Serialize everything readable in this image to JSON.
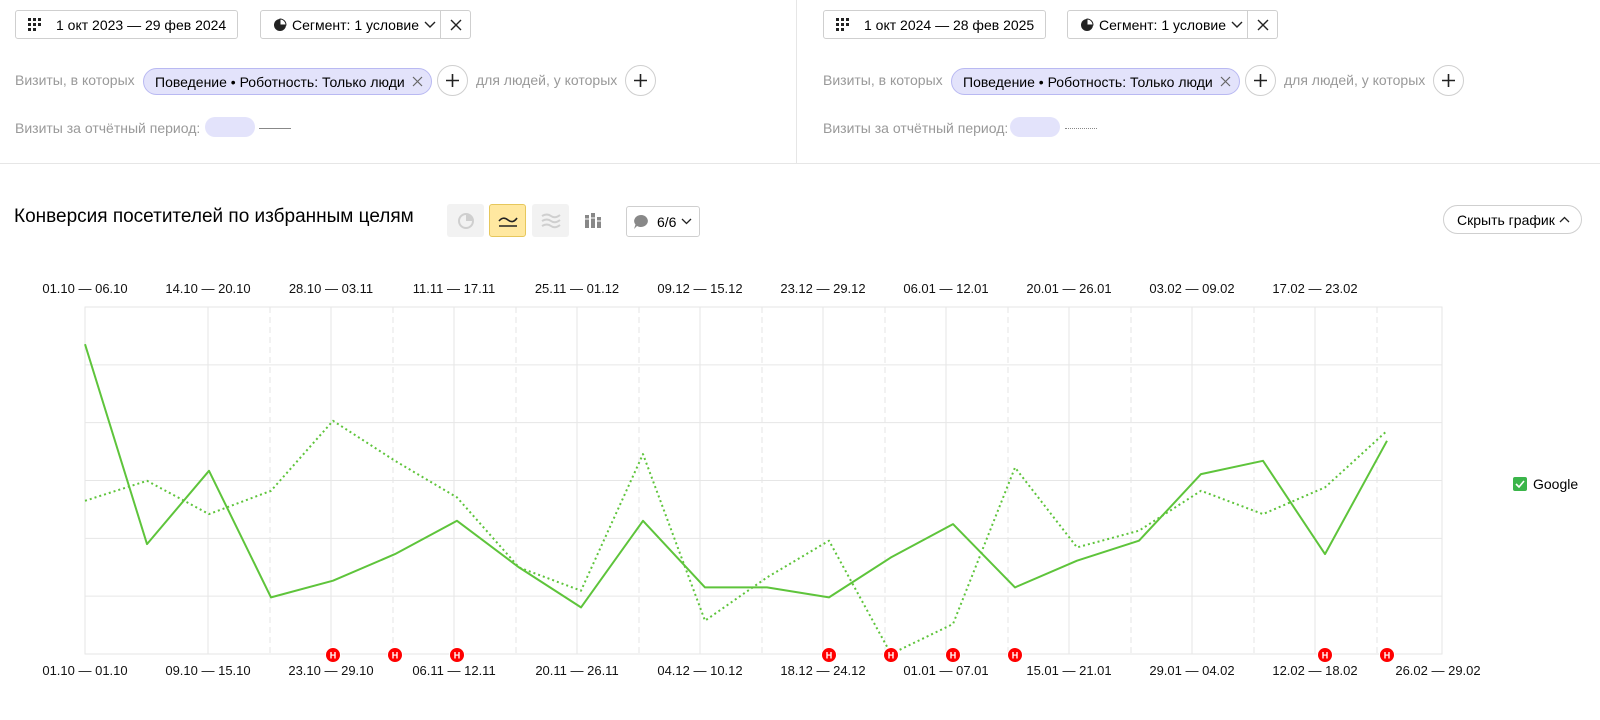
{
  "left_panel": {
    "date_range": "1 окт 2023 — 29 фев 2024",
    "segment_label": "Сегмент: 1 условие",
    "visits_where": "Визиты, в которых",
    "chip": "Поведение • Роботность: Только люди",
    "for_people": "для людей, у которых",
    "visits_period": "Визиты за отчётный период:"
  },
  "right_panel": {
    "date_range": "1 окт 2024 — 28 фев 2025",
    "segment_label": "Сегмент: 1 условие",
    "visits_where": "Визиты, в которых",
    "chip": "Поведение • Роботность: Только люди",
    "for_people": "для людей, у которых",
    "visits_period": "Визиты за отчётный период:"
  },
  "toolbar": {
    "title": "Конверсия посетителей по избранным целям",
    "notes_count": "6/6",
    "hide_chart": "Скрыть график"
  },
  "colors": {
    "series": "#5ec43b",
    "accent": "#ffe8a0",
    "note": "#f00",
    "grid": "#e6e6e6"
  },
  "chart_data": {
    "type": "line",
    "title": "Конверсия посетителей по избранным целям",
    "grid": true,
    "legend_position": "right",
    "y_tick_label": "",
    "ylim": [
      0,
      100
    ],
    "x_top_labels": [
      "01.10 — 06.10",
      "14.10 — 20.10",
      "28.10 — 03.11",
      "11.11 — 17.11",
      "25.11 — 01.12",
      "09.12 — 15.12",
      "23.12 — 29.12",
      "06.01 — 12.01",
      "20.01 — 26.01",
      "03.02 — 09.02",
      "17.02 — 23.02"
    ],
    "x_bottom_labels": [
      "01.10 — 01.10",
      "09.10 — 15.10",
      "23.10 — 29.10",
      "06.11 — 12.11",
      "20.11 — 26.11",
      "04.12 — 10.12",
      "18.12 — 24.12",
      "01.01 — 07.01",
      "15.01 — 21.01",
      "29.01 — 04.02",
      "12.02 — 18.02",
      "26.02 — 29.02"
    ],
    "series": [
      {
        "name": "Google",
        "style": "solid",
        "points": [
          [
            0,
            93
          ],
          [
            1,
            33
          ],
          [
            2,
            55
          ],
          [
            3,
            17
          ],
          [
            4,
            22
          ],
          [
            5,
            30
          ],
          [
            6,
            40
          ],
          [
            7,
            26
          ],
          [
            8,
            14
          ],
          [
            9,
            40
          ],
          [
            10,
            20
          ],
          [
            11,
            20
          ],
          [
            12,
            17
          ],
          [
            13,
            29
          ],
          [
            14,
            39
          ],
          [
            15,
            20
          ],
          [
            16,
            28
          ],
          [
            17,
            34
          ],
          [
            18,
            54
          ],
          [
            19,
            58
          ],
          [
            20,
            30
          ],
          [
            21,
            64
          ]
        ]
      },
      {
        "name": "Google",
        "style": "dotted",
        "points": [
          [
            0,
            46
          ],
          [
            1,
            52
          ],
          [
            2,
            42
          ],
          [
            3,
            49
          ],
          [
            4,
            70
          ],
          [
            5,
            58
          ],
          [
            6,
            47
          ],
          [
            7,
            26
          ],
          [
            8,
            19
          ],
          [
            9,
            60
          ],
          [
            10,
            10
          ],
          [
            11,
            23
          ],
          [
            12,
            34
          ],
          [
            13,
            0
          ],
          [
            14,
            9
          ],
          [
            15,
            56
          ],
          [
            16,
            32
          ],
          [
            17,
            37
          ],
          [
            18,
            49
          ],
          [
            19,
            42
          ],
          [
            20,
            50
          ],
          [
            21,
            67
          ]
        ]
      }
    ],
    "notes_at": [
      4,
      5,
      6,
      12,
      13,
      14,
      15,
      20,
      21
    ],
    "note_label": "H"
  },
  "legend": {
    "google": "Google"
  }
}
